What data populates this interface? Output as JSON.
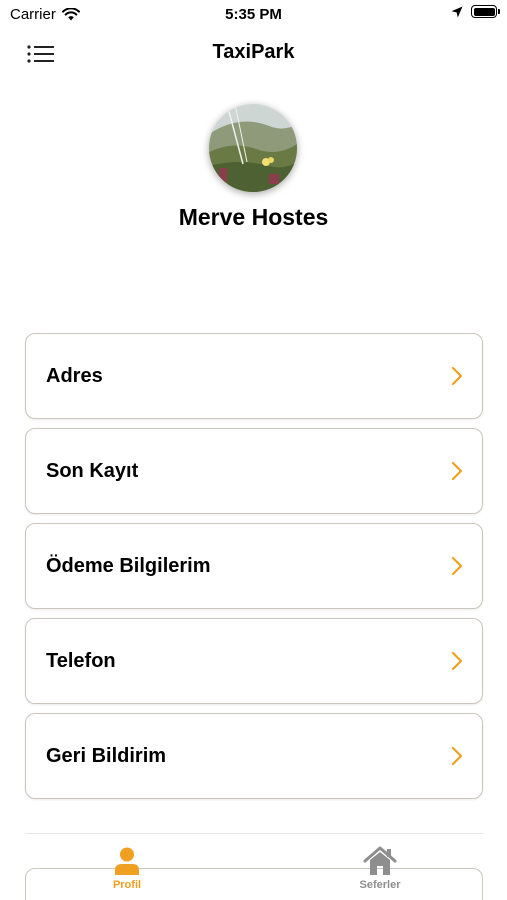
{
  "status_bar": {
    "carrier": "Carrier",
    "time": "5:35 PM"
  },
  "nav": {
    "title": "TaxiPark"
  },
  "profile": {
    "name": "Merve Hostes"
  },
  "menu": {
    "items": [
      {
        "label": "Adres"
      },
      {
        "label": "Son Kayıt"
      },
      {
        "label": "Ödeme Bilgilerim"
      },
      {
        "label": "Telefon"
      },
      {
        "label": "Geri Bildirim"
      }
    ]
  },
  "tabs": [
    {
      "label": "Profil",
      "icon": "person-icon",
      "active": true
    },
    {
      "label": "Seferler",
      "icon": "home-icon",
      "active": false
    }
  ],
  "colors": {
    "accent": "#f0a020",
    "inactive_tab": "#8e8e8e",
    "card_border": "#cbc6bd"
  }
}
